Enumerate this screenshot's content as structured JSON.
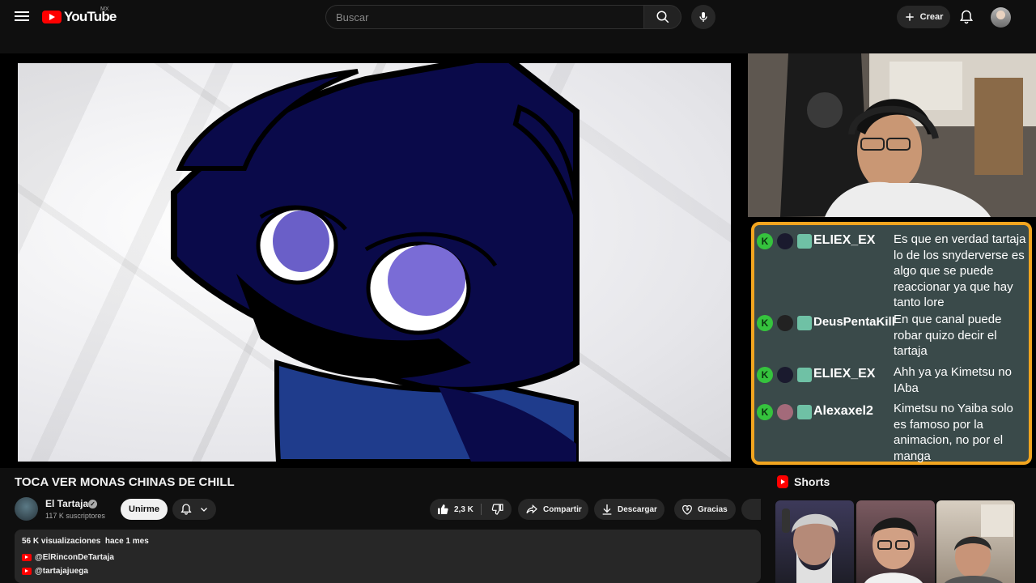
{
  "header": {
    "logo_text": "YouTube",
    "country_code": "MX",
    "search_placeholder": "Buscar",
    "create_label": "Crear"
  },
  "live_chat": [
    {
      "user": "ELIEX_EX",
      "text": "Es que en verdad tartaja lo de los snyderverse es algo que se puede reaccionar ya que hay tanto lore"
    },
    {
      "user": "DeusPentaKill",
      "text": "En que canal puede robar quizo decir el tartaja"
    },
    {
      "user": "ELIEX_EX",
      "text": "Ahh ya ya Kimetsu no IAba"
    },
    {
      "user": "Alexaxel2",
      "text": "Kimetsu no Yaiba solo es famoso por la animacion, no por el manga"
    }
  ],
  "chat_badge_letter": "K",
  "video": {
    "title": "TOCA VER MONAS CHINAS DE CHILL"
  },
  "channel": {
    "name": "El Tartaja",
    "subscribers": "117 K suscriptores",
    "join_label": "Unirme",
    "verified_mark": "✓"
  },
  "actions": {
    "likes": "2,3 K",
    "share_label": "Compartir",
    "download_label": "Descargar",
    "thanks_label": "Gracias"
  },
  "description": {
    "views": "56 K visualizaciones",
    "date": "hace 1 mes",
    "links": [
      "@ElRinconDeTartaja",
      "@tartajajuega"
    ]
  },
  "shorts": {
    "heading": "Shorts"
  },
  "colors": {
    "accent_red": "#ff0000",
    "chat_border": "#f2a51f",
    "chat_badge_green": "#35c33d",
    "background": "#0f0f0f"
  }
}
